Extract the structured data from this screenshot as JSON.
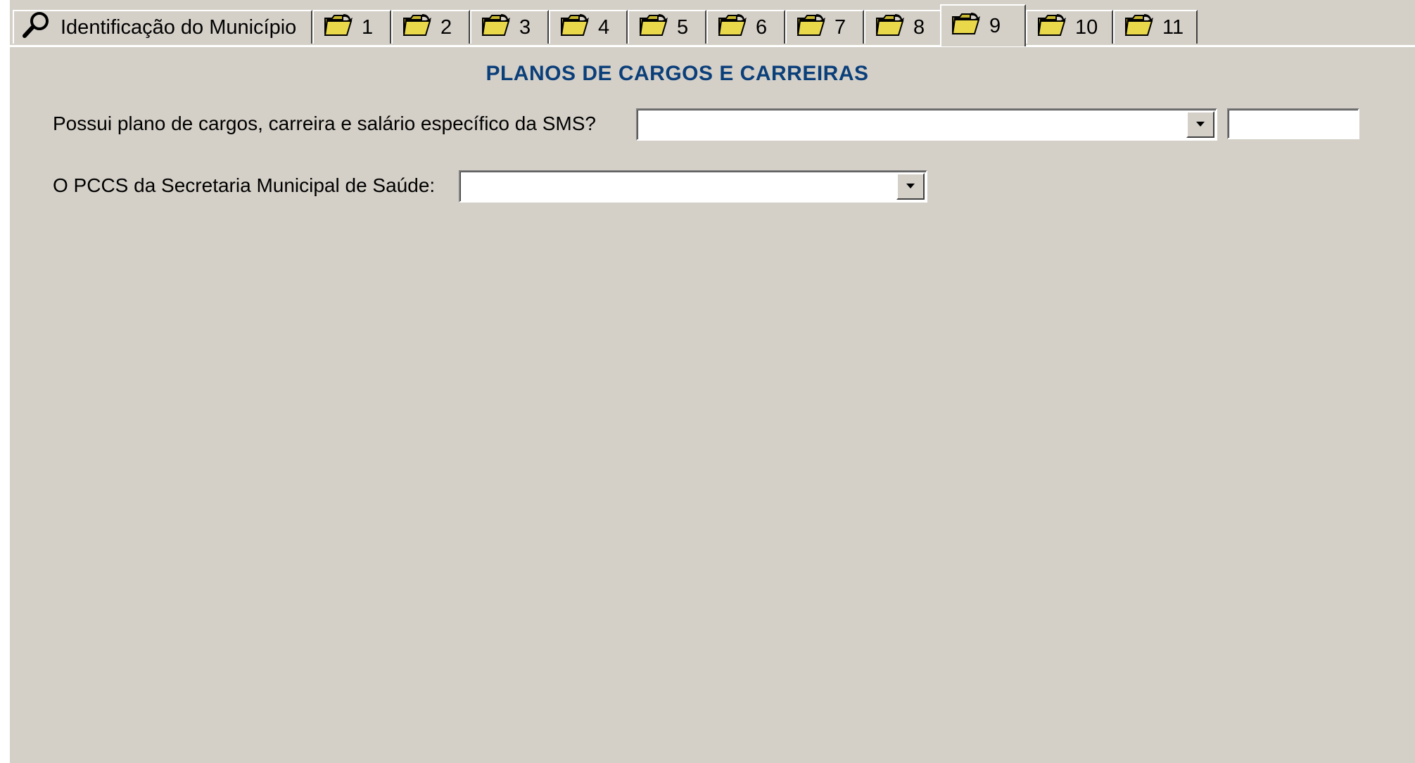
{
  "tabs": [
    {
      "label": "Identificação do Município",
      "icon": "search-icon"
    },
    {
      "label": "1",
      "icon": "folder-open-icon"
    },
    {
      "label": "2",
      "icon": "folder-open-icon"
    },
    {
      "label": "3",
      "icon": "folder-open-icon"
    },
    {
      "label": "4",
      "icon": "folder-open-icon"
    },
    {
      "label": "5",
      "icon": "folder-open-icon"
    },
    {
      "label": "6",
      "icon": "folder-open-icon"
    },
    {
      "label": "7",
      "icon": "folder-open-icon"
    },
    {
      "label": "8",
      "icon": "folder-open-icon"
    },
    {
      "label": "9",
      "icon": "folder-open-icon",
      "active": true
    },
    {
      "label": "10",
      "icon": "folder-open-icon"
    },
    {
      "label": "11",
      "icon": "folder-open-icon"
    }
  ],
  "section": {
    "title": "PLANOS DE CARGOS E CARREIRAS"
  },
  "form": {
    "q1": {
      "label": "Possui plano de cargos, carreira e salário específico da  SMS?",
      "value": "",
      "extra_value": ""
    },
    "q2": {
      "label": "O PCCS da Secretaria Municipal de Saúde:",
      "value": ""
    }
  },
  "colors": {
    "background": "#d4d0c8",
    "heading": "#0b3f7a",
    "folder": "#e8d84a"
  }
}
